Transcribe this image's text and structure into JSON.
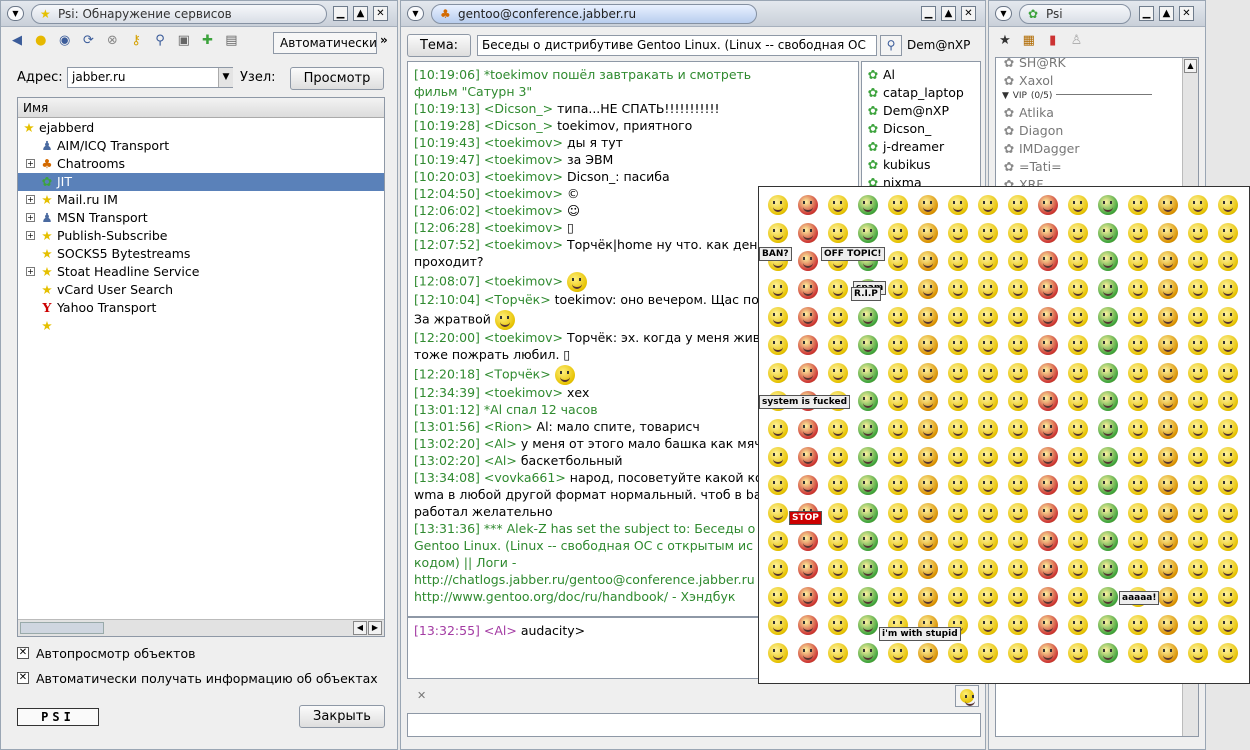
{
  "service_window": {
    "title": "Psi: Обнаружение сервисов",
    "tab_label": "Автоматически",
    "address_label": "Адрес:",
    "address_value": "jabber.ru",
    "node_label": "Узел:",
    "browse_label": "Просмотр",
    "column_header": "Имя",
    "tree": [
      {
        "label": "ejabberd",
        "icon": "star-icon"
      },
      {
        "label": "AIM/ICQ Transport",
        "icon": "person-icon"
      },
      {
        "label": "Chatrooms",
        "icon": "group-icon"
      },
      {
        "label": "JIT",
        "icon": "flower-icon"
      },
      {
        "label": "Mail.ru IM",
        "icon": "star-icon"
      },
      {
        "label": "MSN Transport",
        "icon": "person-icon"
      },
      {
        "label": "Publish-Subscribe",
        "icon": "star-icon"
      },
      {
        "label": "SOCKS5 Bytestreams",
        "icon": "star-icon"
      },
      {
        "label": "Stoat Headline Service",
        "icon": "star-icon"
      },
      {
        "label": "vCard User Search",
        "icon": "star-icon"
      },
      {
        "label": "Yahoo Transport",
        "icon": "yahoo-icon"
      },
      {
        "label": "",
        "icon": "star-icon"
      }
    ],
    "auto_browse_label": "Автопросмотр объектов",
    "auto_info_label": "Автоматически получать информацию об объектах",
    "psi_label": "PSI",
    "close_label": "Закрыть"
  },
  "chat_window": {
    "title": "gentoo@conference.jabber.ru",
    "topic_label": "Тема:",
    "topic_value": "Беседы о дистрибутиве Gentoo Linux. (Linux -- свободная ОС",
    "nick_display": "Dem@nXP",
    "messages": [
      {
        "ts": "[10:19:06]",
        "text": " *toekimov пошёл завтракать и смотреть",
        "cls": "sys"
      },
      {
        "ts": "",
        "text": "фильм  \"Сатурн 3\"",
        "cls": "sys"
      },
      {
        "ts": "[10:19:13]",
        "nick": " <Dicson_>",
        "text": " типа...НЕ СПАТЬ!!!!!!!!!!!",
        "cls": ""
      },
      {
        "ts": "[10:19:28]",
        "nick": " <Dicson_>",
        "text": " toekimov, приятного",
        "cls": ""
      },
      {
        "ts": "[10:19:43]",
        "nick": " <toekimov>",
        "text": " ды я тут",
        "cls": ""
      },
      {
        "ts": "[10:19:47]",
        "nick": " <toekimov>",
        "text": " за ЭВМ",
        "cls": ""
      },
      {
        "ts": "[10:20:03]",
        "nick": " <toekimov>",
        "text": " Dicson_: пасиба",
        "cls": ""
      },
      {
        "ts": "[12:04:50]",
        "nick": " <toekimov>",
        "text": " ©",
        "cls": ""
      },
      {
        "ts": "[12:06:02]",
        "nick": " <toekimov>",
        "text": " ☺",
        "cls": ""
      },
      {
        "ts": "[12:06:28]",
        "nick": " <toekimov>",
        "text": " ▯",
        "cls": ""
      },
      {
        "ts": "[12:07:52]",
        "nick": " <toekimov>",
        "text": " Торчёк|home ну что. как день в",
        "cls": ""
      },
      {
        "ts": "",
        "text": "проходит?",
        "cls": ""
      },
      {
        "ts": "[12:08:07]",
        "nick": " <toekimov>",
        "text": "",
        "cls": "",
        "smiley": true
      },
      {
        "ts": "[12:10:04]",
        "nick": " <Торчёк>",
        "text": " toekimov: оно вечером. Щас по м",
        "cls": ""
      },
      {
        "ts": "",
        "text": "За жратвой",
        "cls": "",
        "smiley": true
      },
      {
        "ts": "[12:20:00]",
        "nick": " <toekimov>",
        "text": " Торчёк: эх. когда у меня живот",
        "cls": ""
      },
      {
        "ts": "",
        "text": "тоже пожрать любил. ▯",
        "cls": ""
      },
      {
        "ts": "[12:20:18]",
        "nick": " <Торчёк>",
        "text": "",
        "cls": "",
        "smiley": true
      },
      {
        "ts": "[12:34:39]",
        "nick": " <toekimov>",
        "text": " хех",
        "cls": ""
      },
      {
        "ts": "[13:01:12]",
        "text": " *Al спал 12 часов",
        "cls": "sys"
      },
      {
        "ts": "[13:01:56]",
        "nick": " <Rion>",
        "text": " Al: мало спите, товарисч",
        "cls": ""
      },
      {
        "ts": "[13:02:20]",
        "nick": " <Al>",
        "text": " у меня от этого мало башка как мячи",
        "cls": ""
      },
      {
        "ts": "[13:02:20]",
        "nick": " <Al>",
        "text": " баскетбольный",
        "cls": ""
      },
      {
        "ts": "[13:34:08]",
        "nick": " <vovka661>",
        "text": " народ, посоветуйте какой кон",
        "cls": ""
      },
      {
        "ts": "",
        "text": "wma в любой другой формат нормальный. чтоб в ba",
        "cls": ""
      },
      {
        "ts": "",
        "text": "работал желательно",
        "cls": ""
      },
      {
        "ts": "[13:31:36]",
        "text": " *** Alek-Z has set the subject to: Беседы о д",
        "cls": "sys"
      },
      {
        "ts": "",
        "text": "Gentoo Linux. (Linux -- свободная ОС с открытым ис",
        "cls": "sys"
      },
      {
        "ts": "",
        "text": "кодом) || Логи -",
        "cls": "sys"
      },
      {
        "ts": "",
        "text": "http://chatlogs.jabber.ru/gentoo@conference.jabber.ru",
        "cls": "sys"
      },
      {
        "ts": "",
        "text": "http://www.gentoo.org/doc/ru/handbook/ - Хэндбук",
        "cls": "sys"
      }
    ],
    "own_message": {
      "ts": "[13:32:55]",
      "nick": " <Al>",
      "text": " audacity>"
    },
    "members": [
      "Al",
      "catap_laptop",
      "Dem@nXP",
      "Dicson_",
      "j-dreamer",
      "kubikus",
      "nixma"
    ]
  },
  "roster_window": {
    "title": "Psi",
    "contacts_top": [
      "SH@RK",
      "Xaxol"
    ],
    "group_label": "VIP",
    "group_count": "(0/5)",
    "contacts": [
      "Atlika",
      "Diagon",
      "IMDagger",
      "=Tati=",
      "XRF"
    ]
  },
  "emoticon_popup": {
    "labels": [
      "BAN?",
      "OFF TOPIC!",
      "spam",
      "R.I.P",
      "STOP",
      "system is fucked",
      "i'm with stupid",
      "aaaaa!"
    ]
  },
  "colors": {
    "accent": "#5a81b9",
    "timestamp": "#2f8a2f",
    "own": "#a33ba3"
  }
}
